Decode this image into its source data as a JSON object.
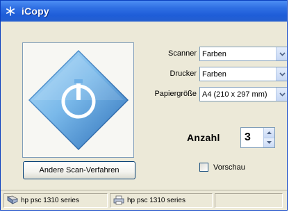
{
  "window": {
    "title": "iCopy",
    "title_icon": "app-snowflake-icon"
  },
  "colors": {
    "titlebar": "#2f6fe3",
    "window_bg": "#ece9d8",
    "diamond_light": "#8cc8f0",
    "diamond_dark": "#2d6fb8"
  },
  "preview": {
    "graphic_icon": "power-diamond-icon"
  },
  "buttons": {
    "alt_scan_label": "Andere Scan-Verfahren"
  },
  "settings": {
    "scanner_label": "Scanner",
    "scanner_value": "Farben",
    "printer_label": "Drucker",
    "printer_value": "Farben",
    "paper_label": "Papiergröße",
    "paper_value": "A4 (210 x 297 mm)"
  },
  "copies": {
    "label": "Anzahl",
    "value": "3"
  },
  "preview_option": {
    "label": "Vorschau",
    "checked": false
  },
  "statusbar": {
    "scanner_device": "hp psc 1310 series",
    "printer_device": "hp psc 1310 series"
  }
}
